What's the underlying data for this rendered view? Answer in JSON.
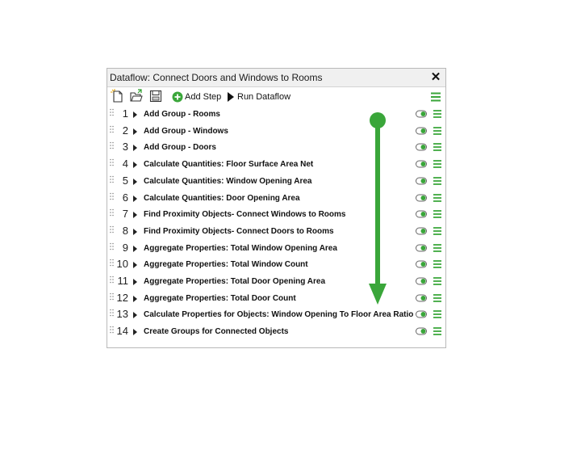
{
  "window": {
    "title": "Dataflow: Connect Doors and Windows to Rooms",
    "close_glyph": "✕"
  },
  "toolbar": {
    "icons": [
      "new-document-icon",
      "open-folder-icon",
      "save-icon"
    ],
    "add_step_label": "Add Step",
    "run_dataflow_label": "Run Dataflow"
  },
  "steps": [
    {
      "num": "1",
      "label": "Add Group - Rooms"
    },
    {
      "num": "2",
      "label": "Add Group - Windows"
    },
    {
      "num": "3",
      "label": "Add Group - Doors"
    },
    {
      "num": "4",
      "label": "Calculate Quantities: Floor Surface Area Net"
    },
    {
      "num": "5",
      "label": "Calculate Quantities: Window Opening Area"
    },
    {
      "num": "6",
      "label": "Calculate Quantities: Door Opening Area"
    },
    {
      "num": "7",
      "label": "Find Proximity Objects- Connect Windows to Rooms"
    },
    {
      "num": "8",
      "label": "Find Proximity Objects- Connect Doors to Rooms"
    },
    {
      "num": "9",
      "label": "Aggregate Properties: Total Window Opening Area"
    },
    {
      "num": "10",
      "label": "Aggregate Properties: Total Window Count"
    },
    {
      "num": "11",
      "label": "Aggregate Properties: Total Door Opening Area"
    },
    {
      "num": "12",
      "label": "Aggregate Properties: Total Door Count"
    },
    {
      "num": "13",
      "label": "Calculate Properties for Objects: Window Opening To Floor Area Ratio"
    },
    {
      "num": "14",
      "label": "Create Groups for Connected Objects"
    }
  ],
  "colors": {
    "accent_green": "#3aa63a",
    "title_bar": "#f0f0f0",
    "border": "#b9b9b9"
  }
}
